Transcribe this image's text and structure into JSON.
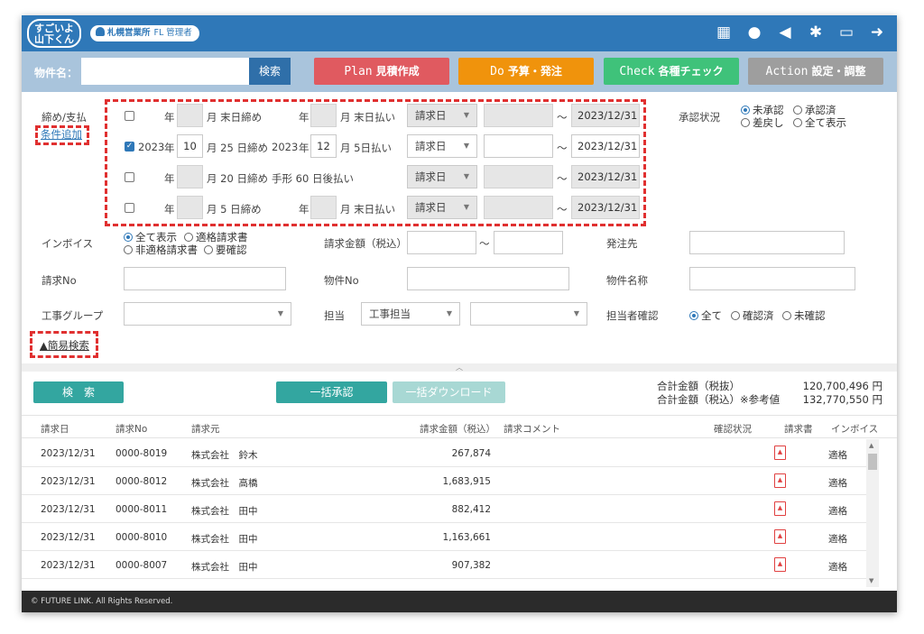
{
  "header": {
    "logo_line1": "すごいよ",
    "logo_line2": "山下くん",
    "office": "札幌営業所",
    "role": "FL 管理者",
    "icons": [
      "building-icon",
      "chat-icon",
      "megaphone-icon",
      "gear-icon",
      "folder-icon",
      "logout-icon"
    ]
  },
  "command": {
    "property_label": "物件名：",
    "property_value": "",
    "search_label": "検索",
    "plan_en": "Plan",
    "plan_ja": "見積作成",
    "plan_color": "#e05a60",
    "do_en": "Do",
    "do_ja": "予算・発注",
    "do_color": "#f0930c",
    "check_en": "Check",
    "check_ja": "各種チェック",
    "check_color": "#3fc27a",
    "action_en": "Action",
    "action_ja": "設定・調整",
    "action_color": "#9e9e9e"
  },
  "filters": {
    "close_pay_label": "締め/支払",
    "add_condition": "条件追加",
    "rows": [
      {
        "checked": false,
        "year": "",
        "year_unit": "年",
        "close_month": "",
        "close_text": "月 末日締め",
        "pay_year": "",
        "pay_year_unit": "年",
        "pay_month": "",
        "pay_text": "月 末日払い",
        "basis": "請求日",
        "from": "",
        "to": "2023/12/31"
      },
      {
        "checked": true,
        "year": "2023",
        "year_unit": "年",
        "close_month": "10",
        "close_text": "月 25 日締め",
        "pay_year": "2023",
        "pay_year_unit": "年",
        "pay_month": "12",
        "pay_text": "月 5日払い",
        "basis": "請求日",
        "from": "",
        "to": "2023/12/31"
      },
      {
        "checked": false,
        "year": "",
        "year_unit": "年",
        "close_month": "",
        "close_text": "月 20 日締め",
        "pay_year": "",
        "pay_year_unit": "",
        "pay_month": "",
        "pay_text": "手形 60  日後払い",
        "basis": "請求日",
        "from": "",
        "to": "2023/12/31"
      },
      {
        "checked": false,
        "year": "",
        "year_unit": "年",
        "close_month": "",
        "close_text": "月 5 日締め",
        "pay_year": "",
        "pay_year_unit": "年",
        "pay_month": "",
        "pay_text": "月 末日払い",
        "basis": "請求日",
        "from": "",
        "to": "2023/12/31"
      }
    ],
    "tilde": "〜",
    "approval_label": "承認状況",
    "approval_options": [
      "未承認",
      "承認済",
      "差戻し",
      "全て表示"
    ],
    "approval_selected": "未承認",
    "invoice_label": "インボイス",
    "invoice_options": [
      "全て表示",
      "適格請求書",
      "非適格請求書",
      "要確認"
    ],
    "invoice_selected": "全て表示",
    "amount_label": "請求金額（税込）",
    "order_label": "発注先",
    "billno_label": "請求No",
    "propno_label": "物件No",
    "propname_label": "物件名称",
    "group_label": "工事グループ",
    "staff_label": "担当",
    "staff_select": "工事担当",
    "staffcheck_label": "担当者確認",
    "staffcheck_options": [
      "全て",
      "確認済",
      "未確認"
    ],
    "staffcheck_selected": "全て",
    "simple_search": "▲簡易検索"
  },
  "results": {
    "search_button": "検　索",
    "bulk_approve": "一括承認",
    "bulk_download": "一括ダウンロード",
    "total_ex_label": "合計金額（税抜）",
    "total_ex_value": "120,700,496 円",
    "total_in_label": "合計金額（税込）※参考値",
    "total_in_value": "132,770,550 円",
    "columns": [
      "請求日",
      "請求No",
      "請求元",
      "請求金額（税込）",
      "請求コメント",
      "確認状況",
      "請求書",
      "インボイス"
    ],
    "rows": [
      {
        "date": "2023/12/31",
        "no": "0000-8019",
        "vendor": "株式会社　鈴木",
        "amount": "267,874",
        "invoice": "適格"
      },
      {
        "date": "2023/12/31",
        "no": "0000-8012",
        "vendor": "株式会社　高橋",
        "amount": "1,683,915",
        "invoice": "適格"
      },
      {
        "date": "2023/12/31",
        "no": "0000-8011",
        "vendor": "株式会社　田中",
        "amount": "882,412",
        "invoice": "適格"
      },
      {
        "date": "2023/12/31",
        "no": "0000-8010",
        "vendor": "株式会社　田中",
        "amount": "1,163,661",
        "invoice": "適格"
      },
      {
        "date": "2023/12/31",
        "no": "0000-8007",
        "vendor": "株式会社　田中",
        "amount": "907,382",
        "invoice": "適格"
      }
    ]
  },
  "footer": {
    "copyright": "© FUTURE LINK. All Rights Reserved."
  }
}
